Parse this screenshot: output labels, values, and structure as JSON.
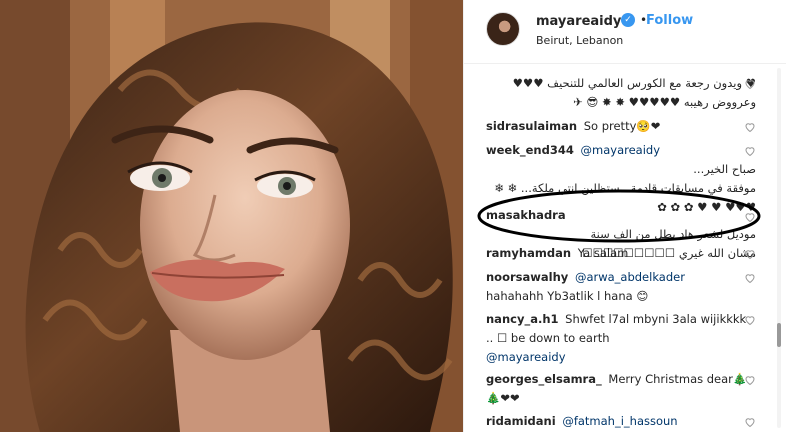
{
  "header": {
    "username": "mayareaidy",
    "separator": "•",
    "follow_label": "Follow",
    "location": "Beirut, Lebanon"
  },
  "comments": [
    {
      "user": "",
      "text": "♥ ويدون رجعة مع الكورس العالمي للتنحيف ♥♥♥\nوعرووض رهيبه ♥♥♥♥♥ ✸ ✸ 😎 ✈"
    },
    {
      "user": "sidrasulaiman",
      "text": "So pretty🥺❤"
    },
    {
      "user": "week_end344",
      "mention": "@mayareaidy",
      "text": "صباح الخير...\nموفقة في مسابقات قادمة ..ستظلين انتي ملكة... ❄ ❄\n✿ ✿ ✿ ♥ ♥ ♥♥♥"
    },
    {
      "user": "masakhadra",
      "text": "موديل لشعر هاد بطل من الف سنة\nمشان الله غيري ☐☐☐☐☐☐☐☐☐"
    },
    {
      "user": "ramyhamdan",
      "text": "Ya salam"
    },
    {
      "user": "noorsawalhy",
      "mention": "@arwa_abdelkader",
      "text": "hahahahh Yb3atlik l hana 😊"
    },
    {
      "user": "nancy_a.h1",
      "text": "Shwfet l7al mbyni 3ala wijikkkk .. ☐ be down to earth",
      "mention_after": "@mayareaidy"
    },
    {
      "user": "georges_elsamra_",
      "text": "Merry Christmas dear🎄🎄❤❤"
    },
    {
      "user": "ridamidani",
      "mention": "@fatmah_i_hassoun",
      "text": ""
    }
  ],
  "colors": {
    "accent": "#3897f0",
    "mention": "#003569",
    "text": "#262626",
    "annotation": "#000000"
  },
  "icons": [
    "verified-badge-icon",
    "heart-icon",
    "avatar-image"
  ]
}
